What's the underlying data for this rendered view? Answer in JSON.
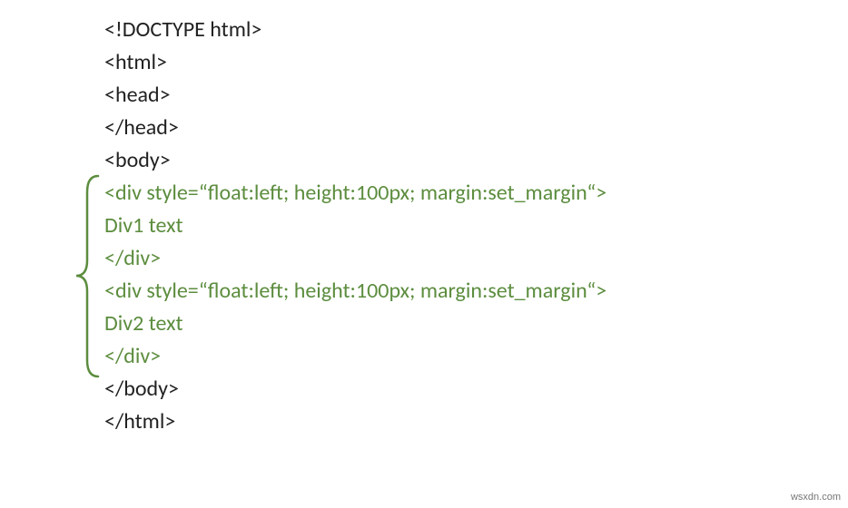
{
  "code": {
    "lines": [
      {
        "text": "<!DOCTYPE html>",
        "style": "dark"
      },
      {
        "text": "<html>",
        "style": "dark"
      },
      {
        "text": "<head>",
        "style": "dark"
      },
      {
        "text": "</head>",
        "style": "dark"
      },
      {
        "text": "<body>",
        "style": "dark"
      },
      {
        "text": "<div style=“float:left; height:100px; margin:set_margin“>",
        "style": "green"
      },
      {
        "text": "Div1 text",
        "style": "green"
      },
      {
        "text": "</div>",
        "style": "green"
      },
      {
        "text": "<div style=“float:left; height:100px; margin:set_margin“>",
        "style": "green"
      },
      {
        "text": "Div2 text",
        "style": "green"
      },
      {
        "text": "</div>",
        "style": "green"
      },
      {
        "text": "</body>",
        "style": "dark"
      },
      {
        "text": "</html>",
        "style": "dark"
      }
    ]
  },
  "bracket_color": "#5c8d3e",
  "watermark": "wsxdn.com"
}
